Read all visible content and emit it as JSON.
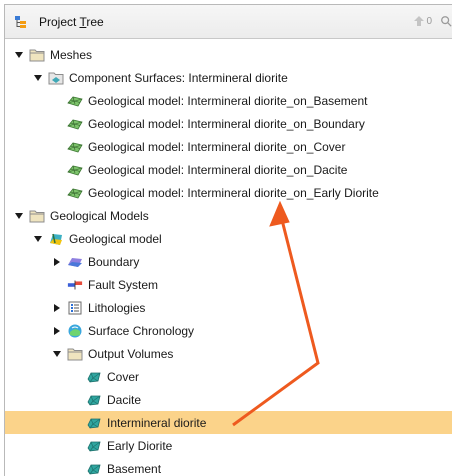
{
  "header": {
    "title_prefix": "Project ",
    "title_underlined": "T",
    "title_suffix": "ree",
    "up_count": "0"
  },
  "tree": [
    {
      "label": "Meshes",
      "depth": 0,
      "expander": "expanded",
      "icon": "folder-icon"
    },
    {
      "label": "Component Surfaces: Intermineral diorite",
      "depth": 1,
      "expander": "expanded",
      "icon": "component-surfaces-icon"
    },
    {
      "label": "Geological model: Intermineral diorite_on_Basement",
      "depth": 2,
      "expander": "none",
      "icon": "mesh-surface-icon"
    },
    {
      "label": "Geological model: Intermineral diorite_on_Boundary",
      "depth": 2,
      "expander": "none",
      "icon": "mesh-surface-icon"
    },
    {
      "label": "Geological model: Intermineral diorite_on_Cover",
      "depth": 2,
      "expander": "none",
      "icon": "mesh-surface-icon"
    },
    {
      "label": "Geological model: Intermineral diorite_on_Dacite",
      "depth": 2,
      "expander": "none",
      "icon": "mesh-surface-icon"
    },
    {
      "label": "Geological model: Intermineral diorite_on_Early Diorite",
      "depth": 2,
      "expander": "none",
      "icon": "mesh-surface-icon"
    },
    {
      "label": "Geological Models",
      "depth": 0,
      "expander": "expanded",
      "icon": "folder-icon"
    },
    {
      "label": "Geological model",
      "depth": 1,
      "expander": "expanded",
      "icon": "geological-model-icon"
    },
    {
      "label": "Boundary",
      "depth": 2,
      "expander": "collapsed",
      "icon": "boundary-icon"
    },
    {
      "label": "Fault System",
      "depth": 2,
      "expander": "none",
      "icon": "fault-system-icon"
    },
    {
      "label": "Lithologies",
      "depth": 2,
      "expander": "collapsed",
      "icon": "lithologies-icon"
    },
    {
      "label": "Surface Chronology",
      "depth": 2,
      "expander": "collapsed",
      "icon": "surface-chronology-icon"
    },
    {
      "label": "Output Volumes",
      "depth": 2,
      "expander": "expanded",
      "icon": "folder-icon"
    },
    {
      "label": "Cover",
      "depth": 3,
      "expander": "none",
      "icon": "volume-icon"
    },
    {
      "label": "Dacite",
      "depth": 3,
      "expander": "none",
      "icon": "volume-icon"
    },
    {
      "label": "Intermineral diorite",
      "depth": 3,
      "expander": "none",
      "icon": "volume-icon",
      "selected": true
    },
    {
      "label": "Early Diorite",
      "depth": 3,
      "expander": "none",
      "icon": "volume-icon"
    },
    {
      "label": "Basement",
      "depth": 3,
      "expander": "none",
      "icon": "volume-icon"
    }
  ],
  "colors": {
    "selection": "#fbd38a",
    "annotation_arrow": "#ee5a1f",
    "folder": "#e8d9a8",
    "volume": "#2fa6a0"
  }
}
